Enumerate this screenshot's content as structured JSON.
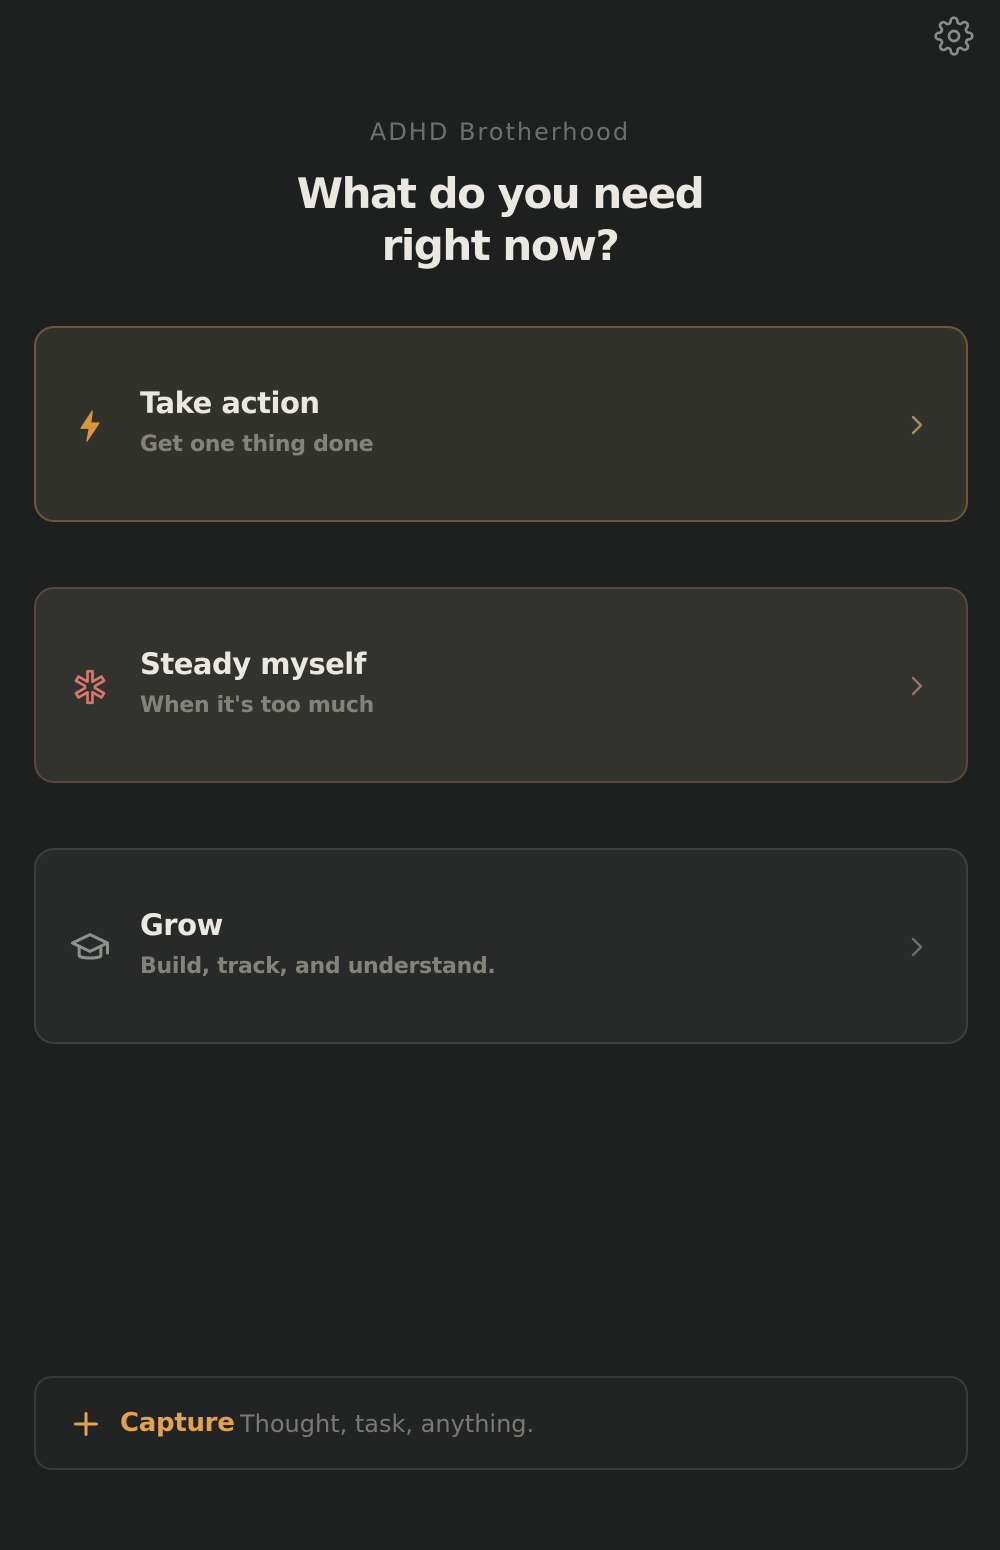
{
  "header": {
    "settings_icon": "gear-icon",
    "brand": "ADHD Brotherhood",
    "title_line1": "What do you need",
    "title_line2": "right now?"
  },
  "options": [
    {
      "title": "Take action",
      "subtitle": "Get one thing done",
      "icon": "lightning-bolt-icon",
      "accent": "#d9963f"
    },
    {
      "title": "Steady myself",
      "subtitle": "When it's too much",
      "icon": "asterisk-icon",
      "accent": "#d37a6c"
    },
    {
      "title": "Grow",
      "subtitle": "Build, track, and understand.",
      "icon": "graduation-cap-icon",
      "accent": "#8f918d"
    }
  ],
  "capture": {
    "icon": "plus-icon",
    "label": "Capture",
    "placeholder": "Thought, task, anything.",
    "value": ""
  },
  "colors": {
    "background": "#1e2020",
    "capture_accent": "#e3a24f"
  }
}
